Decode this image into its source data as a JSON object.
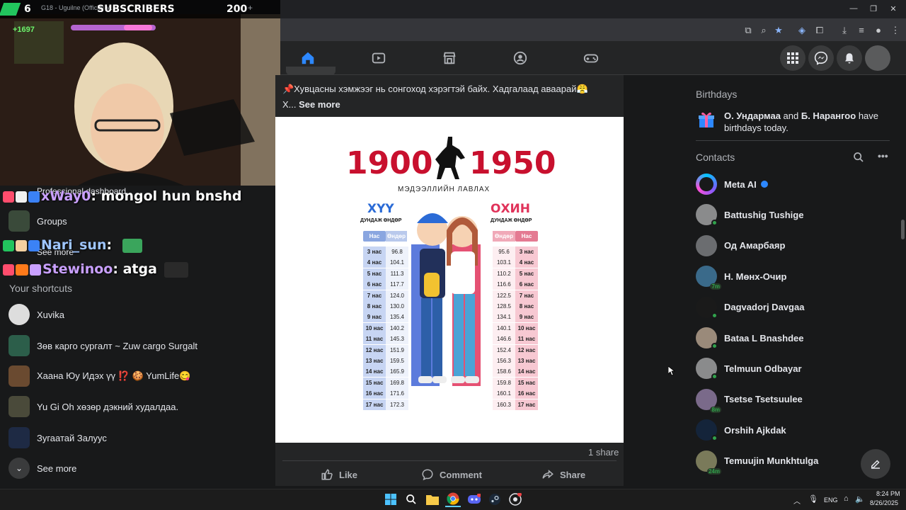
{
  "stream": {
    "sub_count": "6",
    "sub_label": "SUBSCRIBERS",
    "sub_total": "200",
    "tab_title": "G18 - Uguilne (Official M...",
    "top_counter": "+1697"
  },
  "chat": [
    {
      "name": "xWay0",
      "message": "mongol hun bnshd"
    },
    {
      "name": "Nari_sun",
      "message": ""
    },
    {
      "name": "Stewinoo",
      "message": "atga"
    }
  ],
  "left_menu": {
    "dashboard": "Professional dashboard",
    "groups": "Groups",
    "see_more_1": "See more",
    "shortcuts_title": "Your shortcuts",
    "shortcuts": [
      {
        "label": "Xuvika"
      },
      {
        "label": "Зөв карго сургалт ~ Zuw cargo Surgalt"
      },
      {
        "label": "Хаана Юу Идэх үү ⁉️ 🍪 YumLife😋"
      },
      {
        "label": "Yu Gi Oh хөзөр дэкний худалдаа."
      },
      {
        "label": "Зугаатай Залуус"
      }
    ],
    "see_more_2": "See more"
  },
  "post": {
    "text_line1": "📌Хувцасны хэмжээг нь сонгоход хэрэгтэй байх. Хадгалаад аваарай😤",
    "text_line2": "X...",
    "see_more": "See more",
    "shares": "1 share",
    "actions": {
      "like": "Like",
      "comment": "Comment",
      "share": "Share"
    }
  },
  "infographic": {
    "year_left": "1900",
    "year_right": "1950",
    "subtitle": "МЭДЭЭЛЛИЙН ЛАВЛАХ",
    "boys_title": "ХҮҮ",
    "girls_title": "ОХИН",
    "boys_sub": "ДУНДАЖ ӨНДӨР",
    "girls_sub": "ДУНДАЖ ӨНДӨР",
    "col_age": "Нас",
    "col_height": "Өндөр",
    "boys": [
      {
        "age": "3 нас",
        "height": "96.8"
      },
      {
        "age": "4 нас",
        "height": "104.1"
      },
      {
        "age": "5 нас",
        "height": "111.3"
      },
      {
        "age": "6 нас",
        "height": "117.7"
      },
      {
        "age": "7 нас",
        "height": "124.0"
      },
      {
        "age": "8 нас",
        "height": "130.0"
      },
      {
        "age": "9 нас",
        "height": "135.4"
      },
      {
        "age": "10 нас",
        "height": "140.2"
      },
      {
        "age": "11 нас",
        "height": "145.3"
      },
      {
        "age": "12 нас",
        "height": "151.9"
      },
      {
        "age": "13 нас",
        "height": "159.5"
      },
      {
        "age": "14 нас",
        "height": "165.9"
      },
      {
        "age": "15 нас",
        "height": "169.8"
      },
      {
        "age": "16 нас",
        "height": "171.6"
      },
      {
        "age": "17 нас",
        "height": "172.3"
      }
    ],
    "girls": [
      {
        "age": "3 нас",
        "height": "95.6"
      },
      {
        "age": "4 нас",
        "height": "103.1"
      },
      {
        "age": "5 нас",
        "height": "110.2"
      },
      {
        "age": "6 нас",
        "height": "116.6"
      },
      {
        "age": "7 нас",
        "height": "122.5"
      },
      {
        "age": "8 нас",
        "height": "128.5"
      },
      {
        "age": "9 нас",
        "height": "134.1"
      },
      {
        "age": "10 нас",
        "height": "140.1"
      },
      {
        "age": "11 нас",
        "height": "146.6"
      },
      {
        "age": "12 нас",
        "height": "152.4"
      },
      {
        "age": "13 нас",
        "height": "156.3"
      },
      {
        "age": "14 нас",
        "height": "158.6"
      },
      {
        "age": "15 нас",
        "height": "159.8"
      },
      {
        "age": "16 нас",
        "height": "160.1"
      },
      {
        "age": "17 нас",
        "height": "160.3"
      }
    ]
  },
  "right": {
    "birthdays_title": "Birthdays",
    "birthday_name1": "О. Ундармаа",
    "birthday_and": " and ",
    "birthday_name2": "Б. Нарангоо",
    "birthday_tail": " have birthdays today.",
    "contacts_title": "Contacts",
    "contacts": [
      {
        "name": "Meta AI",
        "status": ""
      },
      {
        "name": "Battushig Tushige",
        "status": "online"
      },
      {
        "name": "Од Амарбаяр",
        "status": ""
      },
      {
        "name": "Н. Мөнх-Очир",
        "status": "7m"
      },
      {
        "name": "Dagvadorj Davgaa",
        "status": "online"
      },
      {
        "name": "Bataa L Bnashdee",
        "status": "online"
      },
      {
        "name": "Telmuun Odbayar",
        "status": "online"
      },
      {
        "name": "Tsetse Tsetsuulee",
        "status": "8m"
      },
      {
        "name": "Orshih Ajkdak",
        "status": "online"
      },
      {
        "name": "Temuujin Munkhtulga",
        "status": "24m"
      }
    ]
  },
  "taskbar": {
    "lang": "ENG",
    "time": "8:24 PM",
    "date": "8/26/2025"
  },
  "colors": {
    "fb_blue": "#2d88ff",
    "online_green": "#31a24c",
    "headline_red": "#c8102e"
  }
}
